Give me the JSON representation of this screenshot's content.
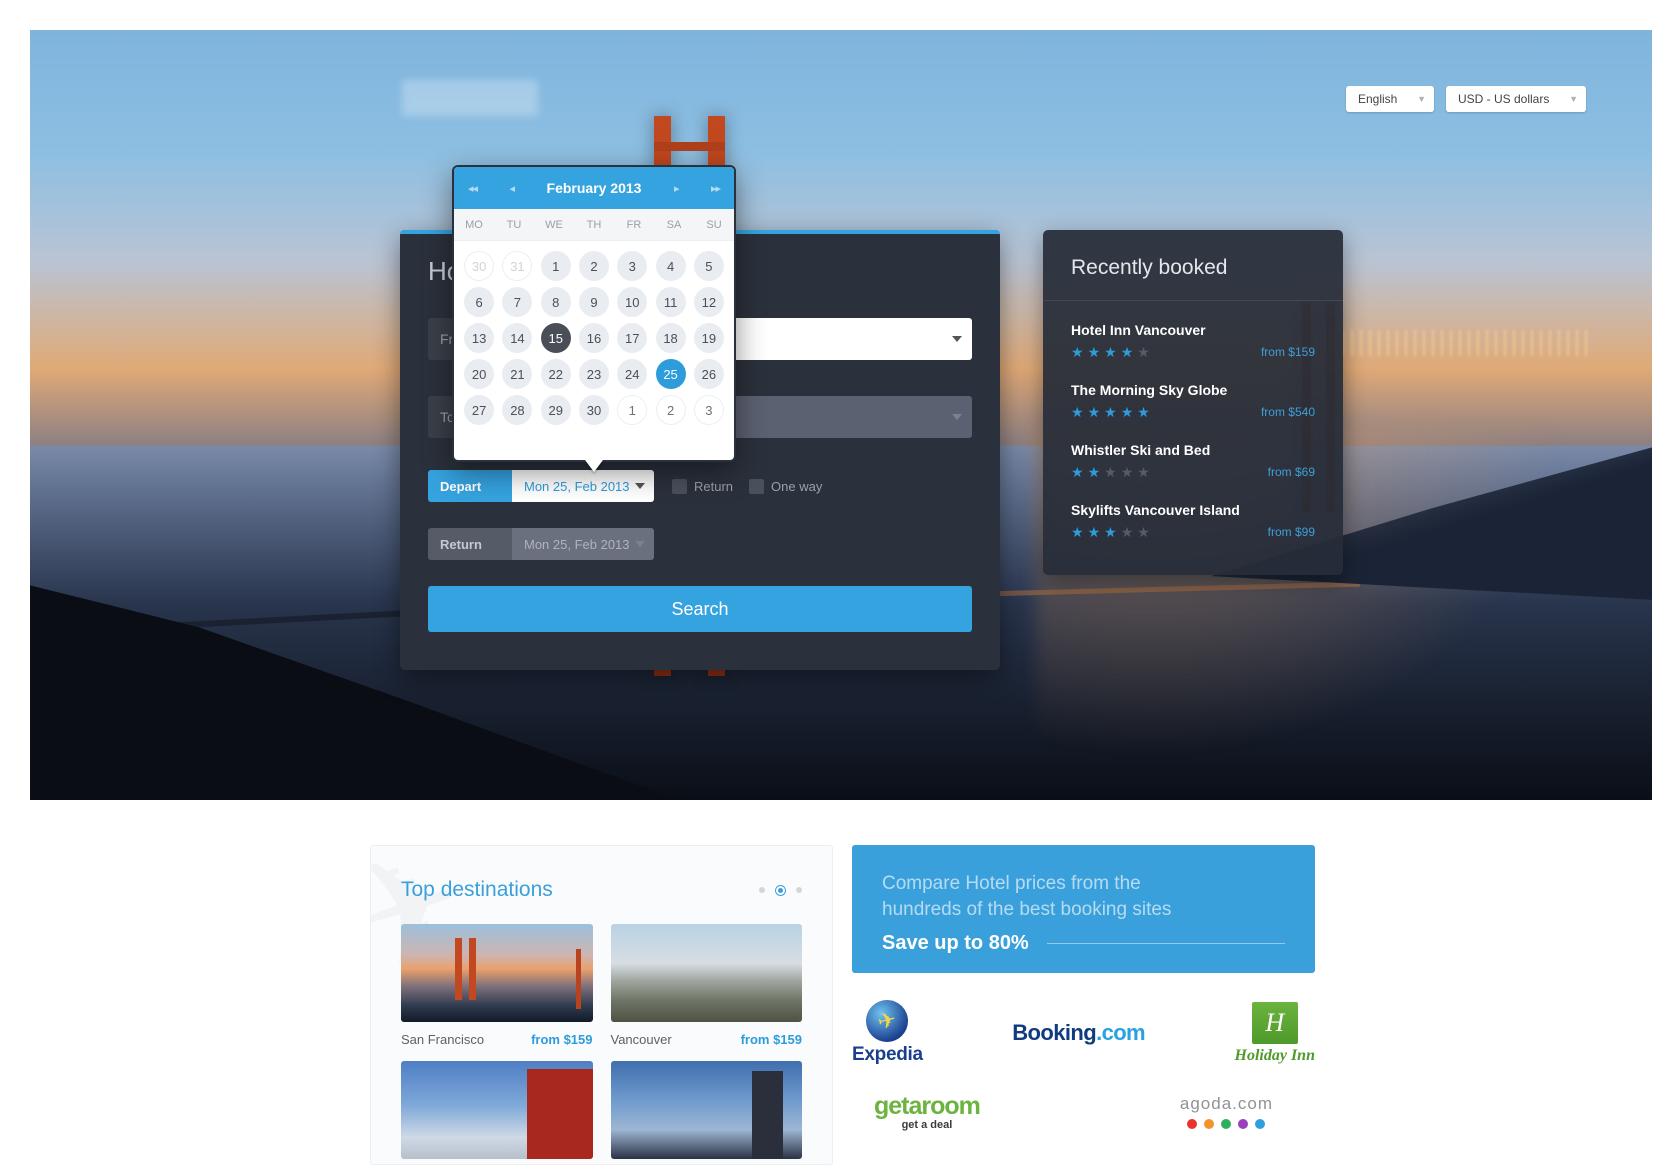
{
  "header": {
    "logo": "logo-placeholder",
    "language": {
      "value": "English",
      "caret": "chevron-down-icon"
    },
    "currency": {
      "value": "USD - US dollars",
      "caret": "chevron-down-icon"
    }
  },
  "search_panel": {
    "title": "Hotels, Flights & Cars",
    "from_placeholder": "From",
    "to_placeholder": "To",
    "destination_value": "",
    "rooms_value": "",
    "depart": {
      "label": "Depart",
      "value": "Mon 25, Feb 2013"
    },
    "return": {
      "label": "Return",
      "value": "Mon 25, Feb 2013"
    },
    "options": [
      {
        "label": "Return",
        "checked": false
      },
      {
        "label": "One way",
        "checked": false
      }
    ],
    "search_label": "Search"
  },
  "calendar": {
    "title": "February 2013",
    "nav": {
      "first": "◂◂",
      "prev": "◂",
      "next": "▸",
      "last": "▸▸"
    },
    "weekdays": [
      "MO",
      "TU",
      "WE",
      "TH",
      "FR",
      "SA",
      "SU"
    ],
    "today": 15,
    "selected": 25,
    "weeks": [
      [
        {
          "d": 30,
          "t": "prev"
        },
        {
          "d": 31,
          "t": "prev"
        },
        {
          "d": 1,
          "t": "cur"
        },
        {
          "d": 2,
          "t": "cur"
        },
        {
          "d": 3,
          "t": "cur"
        },
        {
          "d": 4,
          "t": "cur"
        },
        {
          "d": 5,
          "t": "cur"
        }
      ],
      [
        {
          "d": 6,
          "t": "cur"
        },
        {
          "d": 7,
          "t": "cur"
        },
        {
          "d": 8,
          "t": "cur"
        },
        {
          "d": 9,
          "t": "cur"
        },
        {
          "d": 10,
          "t": "cur"
        },
        {
          "d": 11,
          "t": "cur"
        },
        {
          "d": 12,
          "t": "cur"
        }
      ],
      [
        {
          "d": 13,
          "t": "cur"
        },
        {
          "d": 14,
          "t": "cur"
        },
        {
          "d": 15,
          "t": "today"
        },
        {
          "d": 16,
          "t": "cur"
        },
        {
          "d": 17,
          "t": "cur"
        },
        {
          "d": 18,
          "t": "cur"
        },
        {
          "d": 19,
          "t": "cur"
        }
      ],
      [
        {
          "d": 20,
          "t": "cur"
        },
        {
          "d": 21,
          "t": "cur"
        },
        {
          "d": 22,
          "t": "cur"
        },
        {
          "d": 23,
          "t": "cur"
        },
        {
          "d": 24,
          "t": "cur"
        },
        {
          "d": 25,
          "t": "sel"
        },
        {
          "d": 26,
          "t": "cur"
        }
      ],
      [
        {
          "d": 27,
          "t": "cur"
        },
        {
          "d": 28,
          "t": "cur"
        },
        {
          "d": 29,
          "t": "cur"
        },
        {
          "d": 30,
          "t": "cur"
        },
        {
          "d": 1,
          "t": "next"
        },
        {
          "d": 2,
          "t": "next"
        },
        {
          "d": 3,
          "t": "next"
        }
      ]
    ]
  },
  "recently_booked": {
    "title": "Recently booked",
    "items": [
      {
        "name": "Hotel Inn Vancouver",
        "rating": 4,
        "max_rating": 5,
        "price": "from $159"
      },
      {
        "name": "The Morning Sky Globe",
        "rating": 5,
        "max_rating": 5,
        "price": "from $540"
      },
      {
        "name": "Whistler Ski and Bed",
        "rating": 2,
        "max_rating": 5,
        "price": "from $69"
      },
      {
        "name": "Skylifts Vancouver Island",
        "rating": 3,
        "max_rating": 5,
        "price": "from $99"
      }
    ]
  },
  "top_destinations": {
    "title": "Top destinations",
    "pager": {
      "count": 3,
      "active": 1
    },
    "cards": [
      {
        "city": "San Francisco",
        "price": "from $159",
        "image": "golden-gate-bridge"
      },
      {
        "city": "Vancouver",
        "price": "from $159",
        "image": "coastal-bay"
      },
      {
        "city": "",
        "price": "",
        "image": "mount-fuji-pagoda"
      },
      {
        "city": "",
        "price": "",
        "image": "london-skyline"
      }
    ]
  },
  "promo": {
    "line1": "Compare Hotel prices from the",
    "line2": "hundreds of the best booking sites",
    "highlight": "Save up to 80%"
  },
  "partners": {
    "row1": [
      {
        "name": "Expedia",
        "text": "Expedia"
      },
      {
        "name": "Booking.com",
        "text_dark": "Booking",
        "text_light": ".com"
      },
      {
        "name": "Holiday Inn",
        "mark": "H",
        "text": "Holiday Inn"
      }
    ],
    "row2": [
      {
        "name": "getaroom",
        "text": "getaroom",
        "sub": "get a deal"
      },
      {
        "name": "agoda.com",
        "text": "agoda.com",
        "dot_colors": [
          "#e8342c",
          "#f0952a",
          "#2eae5f",
          "#9b3fbe",
          "#2f9fe0"
        ]
      }
    ]
  },
  "colors": {
    "accent": "#35a3e0",
    "panel_dark": "#2b313c",
    "selected_day": "#2d9cdb",
    "today_day": "#4a4f57"
  }
}
